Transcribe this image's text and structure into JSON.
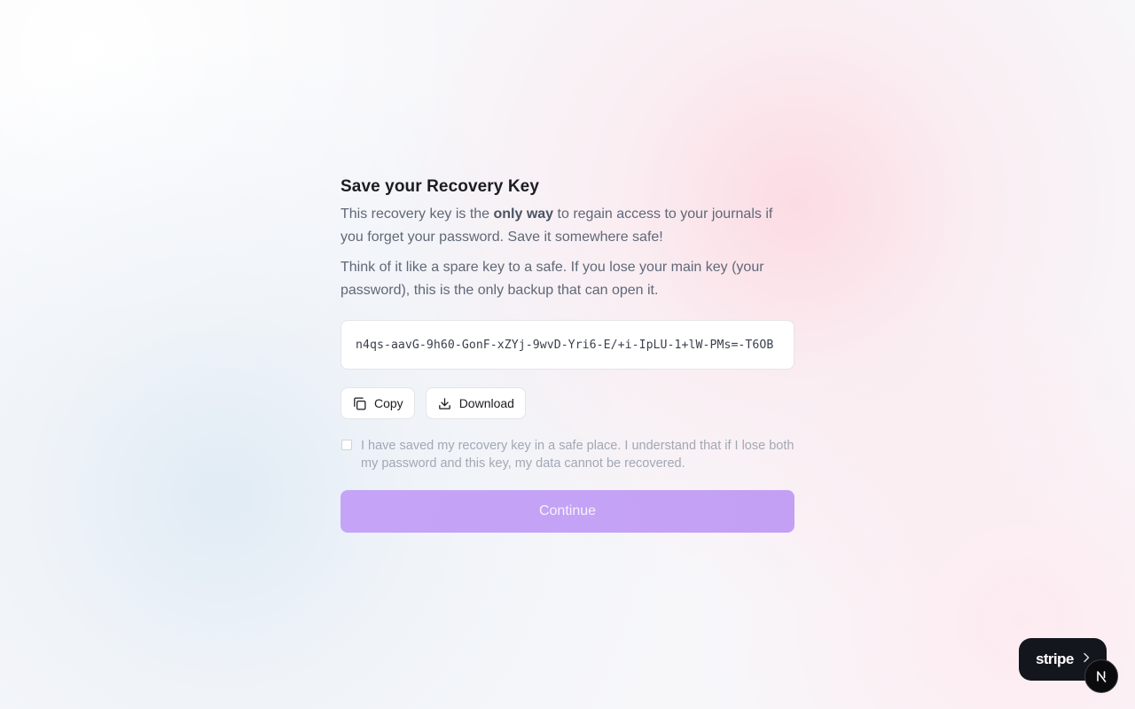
{
  "recovery": {
    "title": "Save your Recovery Key",
    "intro_before": "This recovery key is the ",
    "intro_emphasis": "only way",
    "intro_after": " to regain access to your journals if you forget your password. Save it somewhere safe!",
    "analogy": "Think of it like a spare key to a safe. If you lose your main key (your password), this is the only backup that can open it.",
    "key_value": "n4qs-aavG-9h60-GonF-xZYj-9wvD-Yri6-E/+i-IpLU-1+lW-PMs=-T6OB",
    "copy_label": "Copy",
    "download_label": "Download",
    "confirm_text": "I have saved my recovery key in a safe place. I understand that if I lose both my password and this key, my data cannot be recovered.",
    "confirm_checked": false,
    "continue_label": "Continue",
    "continue_enabled": false
  },
  "badges": {
    "stripe_label": "stripe",
    "stripe_chevron_icon": "chevron-right-icon",
    "next_icon": "nextjs-logo-icon"
  },
  "colors": {
    "accent": "#c4a2f6",
    "badge_bg": "#13161d"
  }
}
